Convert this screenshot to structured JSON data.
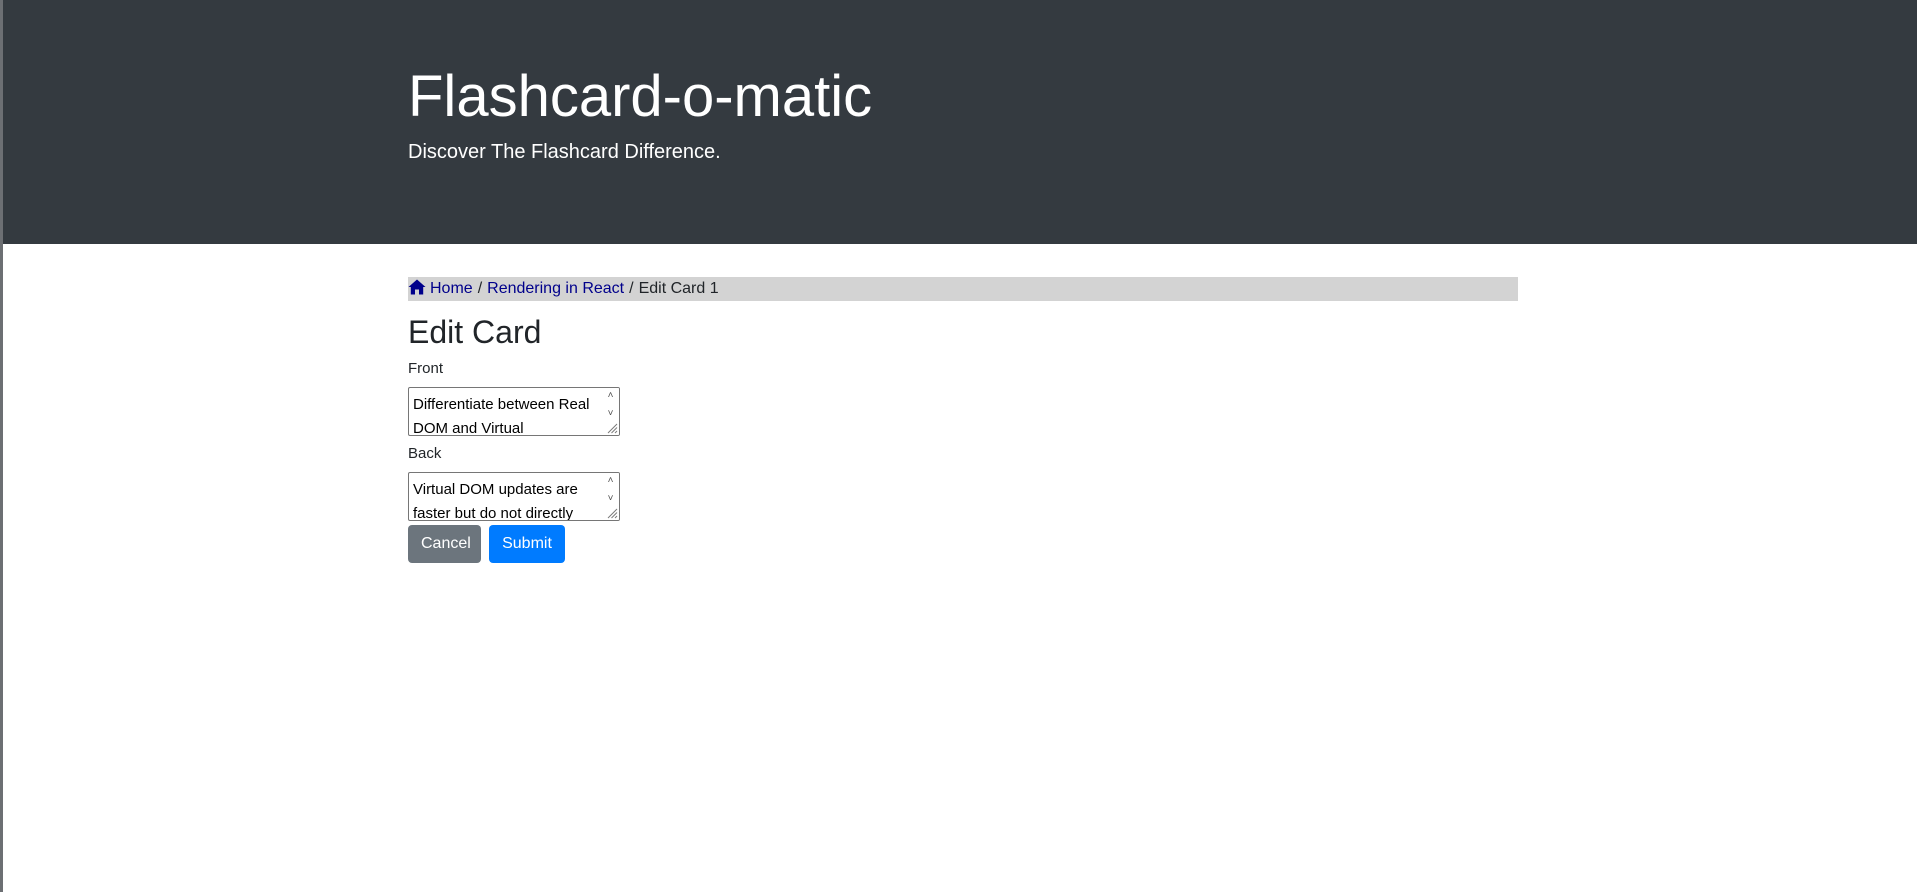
{
  "header": {
    "title": "Flashcard-o-matic",
    "subtitle": "Discover The Flashcard Difference."
  },
  "breadcrumb": {
    "home_icon": "home-icon",
    "home_label": "Home",
    "deck_label": "Rendering in React",
    "current_label": "Edit Card 1",
    "separator": "/"
  },
  "page": {
    "title": "Edit Card"
  },
  "form": {
    "front_label": "Front",
    "front_value": "Differentiate between Real DOM and Virtual",
    "back_label": "Back",
    "back_value": "Virtual DOM updates are faster but do not directly",
    "cancel_label": "Cancel",
    "submit_label": "Submit"
  },
  "colors": {
    "header_bg": "#343a40",
    "breadcrumb_bg": "#d3d3d3",
    "link": "#00008b",
    "cancel_bg": "#6c757d",
    "submit_bg": "#007bff"
  }
}
